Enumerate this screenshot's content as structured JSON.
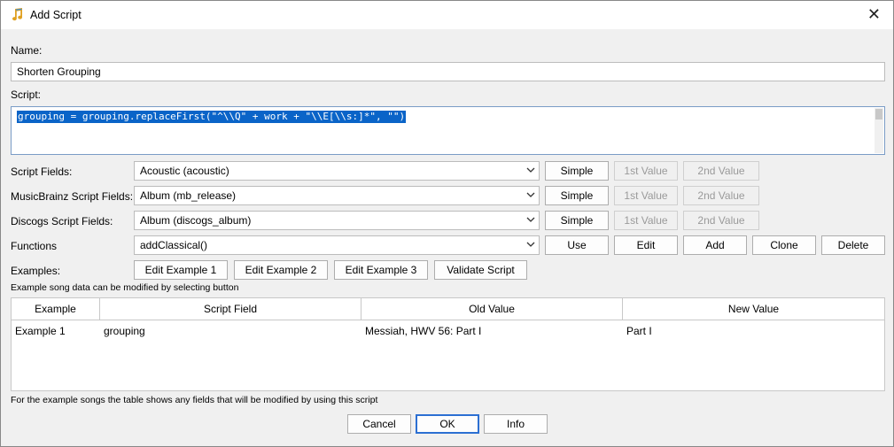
{
  "window": {
    "title": "Add Script"
  },
  "name": {
    "label": "Name:",
    "value": "Shorten Grouping"
  },
  "script": {
    "label": "Script:",
    "code": "grouping = grouping.replaceFirst(\"^\\\\Q\" + work + \"\\\\E[\\\\s:]*\", \"\")"
  },
  "rows": {
    "script_fields": {
      "label": "Script Fields:",
      "value": "Acoustic (acoustic)",
      "b1": "Simple",
      "b2": "1st Value",
      "b3": "2nd Value"
    },
    "mb_fields": {
      "label": "MusicBrainz Script Fields:",
      "value": "Album (mb_release)",
      "b1": "Simple",
      "b2": "1st Value",
      "b3": "2nd Value"
    },
    "discogs_fields": {
      "label": "Discogs Script Fields:",
      "value": "Album (discogs_album)",
      "b1": "Simple",
      "b2": "1st Value",
      "b3": "2nd Value"
    },
    "functions": {
      "label": "Functions",
      "value": "addClassical()",
      "b1": "Use",
      "b2": "Edit",
      "b3": "Add",
      "b4": "Clone",
      "b5": "Delete"
    }
  },
  "examples": {
    "label": "Examples:",
    "btn1": "Edit Example 1",
    "btn2": "Edit Example 2",
    "btn3": "Edit Example 3",
    "validate": "Validate Script",
    "hint": "Example song data can be modified by selecting button"
  },
  "table": {
    "headers": [
      "Example",
      "Script Field",
      "Old Value",
      "New Value"
    ],
    "rows": [
      [
        "Example 1",
        "grouping",
        "Messiah, HWV 56: Part I",
        "Part I"
      ]
    ]
  },
  "footer_note": "For the example songs the table shows any fields that will be modified by using this script",
  "buttons": {
    "cancel": "Cancel",
    "ok": "OK",
    "info": "Info"
  }
}
